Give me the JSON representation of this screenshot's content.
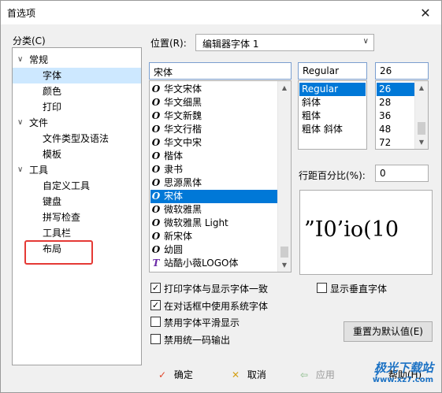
{
  "window": {
    "title": "首选项"
  },
  "category": {
    "label": "分类(C)",
    "items": [
      {
        "label": "常规",
        "toggle": "v"
      },
      {
        "label": "字体"
      },
      {
        "label": "颜色"
      },
      {
        "label": "打印"
      },
      {
        "label": "文件",
        "toggle": "v"
      },
      {
        "label": "文件类型及语法"
      },
      {
        "label": "模板"
      },
      {
        "label": "工具",
        "toggle": "v"
      },
      {
        "label": "自定义工具"
      },
      {
        "label": "键盘"
      },
      {
        "label": "拼写检查"
      },
      {
        "label": "工具栏"
      },
      {
        "label": "布局"
      }
    ]
  },
  "position": {
    "label": "位置(R):",
    "value": "编辑器字体 1"
  },
  "font": {
    "value": "宋体",
    "list": [
      "华文宋体",
      "华文细黑",
      "华文新魏",
      "华文行楷",
      "华文中宋",
      "楷体",
      "隶书",
      "思源黑体",
      "宋体",
      "微软雅黑",
      "微软雅黑 Light",
      "新宋体",
      "幼圆",
      "站酷小薇LOGO体"
    ],
    "selected": "宋体"
  },
  "style": {
    "value": "Regular",
    "list": [
      "Regular",
      "斜体",
      "粗体",
      "粗体 斜体"
    ],
    "selected": "Regular"
  },
  "size": {
    "value": "26",
    "list": [
      "26",
      "28",
      "36",
      "48",
      "72"
    ],
    "selected": "26"
  },
  "line_spacing": {
    "label": "行距百分比(%):",
    "value": "0"
  },
  "preview": {
    "text": "”I0’io(10"
  },
  "options": [
    {
      "label": "打印字体与显示字体一致",
      "checked": true
    },
    {
      "label": "在对话框中使用系统字体",
      "checked": true
    },
    {
      "label": "禁用字体平滑显示",
      "checked": false
    },
    {
      "label": "禁用统一码输出",
      "checked": false
    }
  ],
  "show_vertical_font": {
    "label": "显示垂直字体",
    "checked": false
  },
  "reset_button": "重置为默认值(E)",
  "buttons": {
    "ok": "确定",
    "cancel": "取消",
    "apply": "应用",
    "help": "帮助(H)"
  },
  "watermark": {
    "title": "极光下载站",
    "url": "www.xz7.com"
  },
  "colors": {
    "selection": "#0078d7",
    "tree_selection": "#cde8ff",
    "highlight": "#e53935"
  }
}
